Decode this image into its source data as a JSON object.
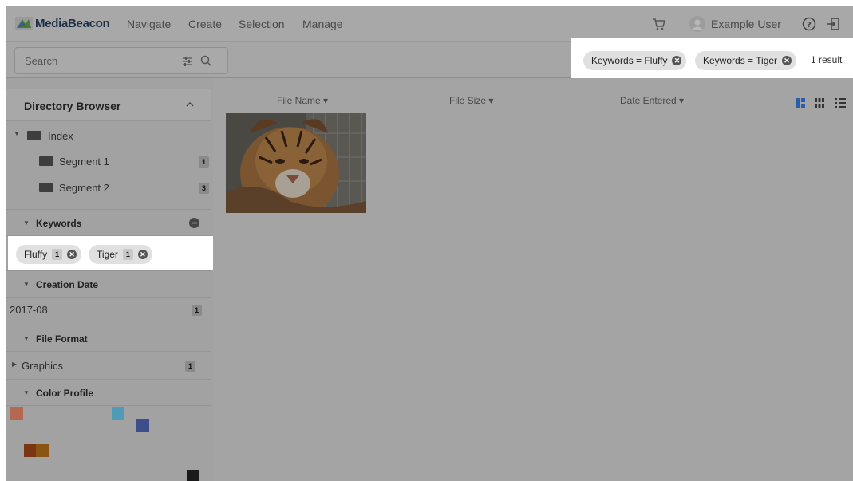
{
  "header": {
    "logo_text": "MediaBeacon",
    "nav": [
      "Navigate",
      "Create",
      "Selection",
      "Manage"
    ],
    "user_name": "Example User"
  },
  "search": {
    "placeholder": "Search"
  },
  "filters": {
    "chips": [
      "Keywords = Fluffy",
      "Keywords = Tiger"
    ],
    "result_count": "1 result"
  },
  "sidebar": {
    "directory": {
      "title": "Directory Browser",
      "root": "Index",
      "items": [
        {
          "label": "Segment 1",
          "count": "1"
        },
        {
          "label": "Segment 2",
          "count": "3"
        }
      ]
    },
    "keywords": {
      "title": "Keywords",
      "chips": [
        {
          "label": "Fluffy",
          "count": "1"
        },
        {
          "label": "Tiger",
          "count": "1"
        }
      ]
    },
    "creation_date": {
      "title": "Creation Date",
      "items": [
        {
          "label": "2017-08",
          "count": "1"
        }
      ]
    },
    "file_format": {
      "title": "File Format",
      "items": [
        {
          "label": "Graphics",
          "count": "1"
        }
      ]
    },
    "color_profile": {
      "title": "Color Profile",
      "swatch_colors": [
        "#b5674f",
        "#4f9ab5",
        "#3c4f8a",
        "#7a3512",
        "#8a5512",
        "#1a1a1a"
      ]
    }
  },
  "results": {
    "columns": [
      "File Name",
      "File Size",
      "Date Entered"
    ]
  },
  "colors": {
    "overlay_gray": "#a4a4a4",
    "logo_green": "#5cb845",
    "logo_blue": "#2a6fbb"
  }
}
